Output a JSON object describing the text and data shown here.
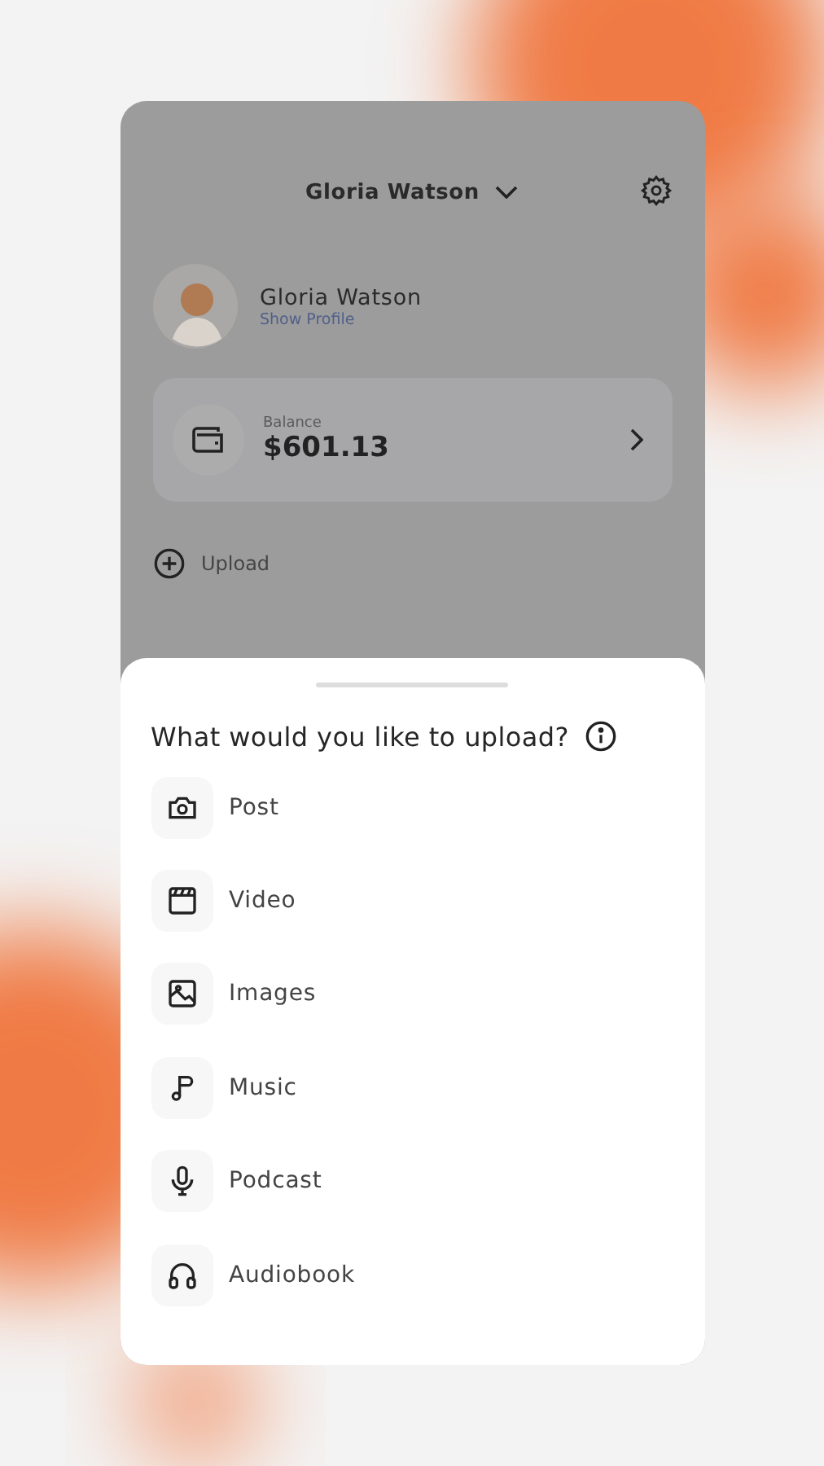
{
  "header": {
    "title": "Gloria Watson"
  },
  "profile": {
    "name": "Gloria Watson",
    "link": "Show Profile"
  },
  "balance": {
    "label": "Balance",
    "amount": "$601.13"
  },
  "upload_action": {
    "label": "Upload"
  },
  "sheet": {
    "title": "What would you like to upload?",
    "options": [
      {
        "label": "Post",
        "kind": "camera"
      },
      {
        "label": "Video",
        "kind": "clapper"
      },
      {
        "label": "Images",
        "kind": "image"
      },
      {
        "label": "Music",
        "kind": "note"
      },
      {
        "label": "Podcast",
        "kind": "mic"
      },
      {
        "label": "Audiobook",
        "kind": "headphones"
      }
    ]
  }
}
